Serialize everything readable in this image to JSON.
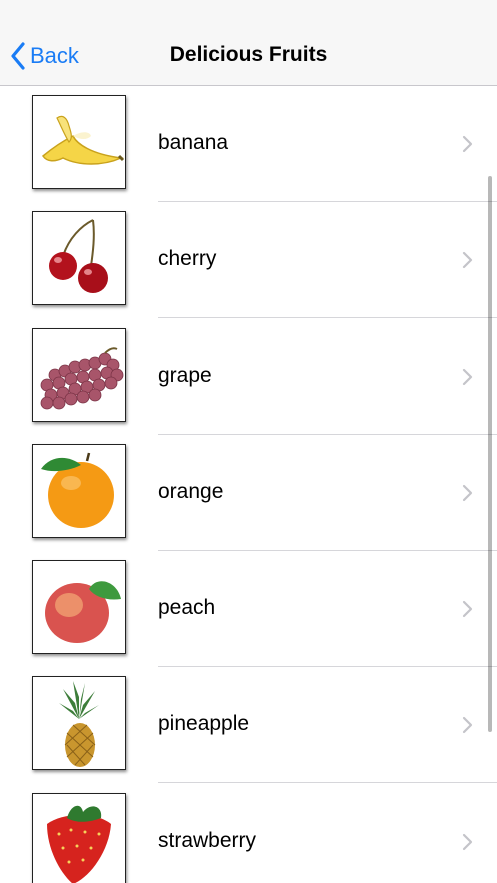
{
  "nav": {
    "back_label": "Back",
    "title": "Delicious Fruits"
  },
  "colors": {
    "accent": "#1a7cf5",
    "nav_background": "#f7f7f7",
    "separator": "#d6d6da",
    "chevron": "#c4c4c9"
  },
  "items": [
    {
      "label": "banana",
      "icon": "banana-icon"
    },
    {
      "label": "cherry",
      "icon": "cherry-icon"
    },
    {
      "label": "grape",
      "icon": "grape-icon"
    },
    {
      "label": "orange",
      "icon": "orange-icon"
    },
    {
      "label": "peach",
      "icon": "peach-icon"
    },
    {
      "label": "pineapple",
      "icon": "pineapple-icon"
    },
    {
      "label": "strawberry",
      "icon": "strawberry-icon"
    }
  ]
}
